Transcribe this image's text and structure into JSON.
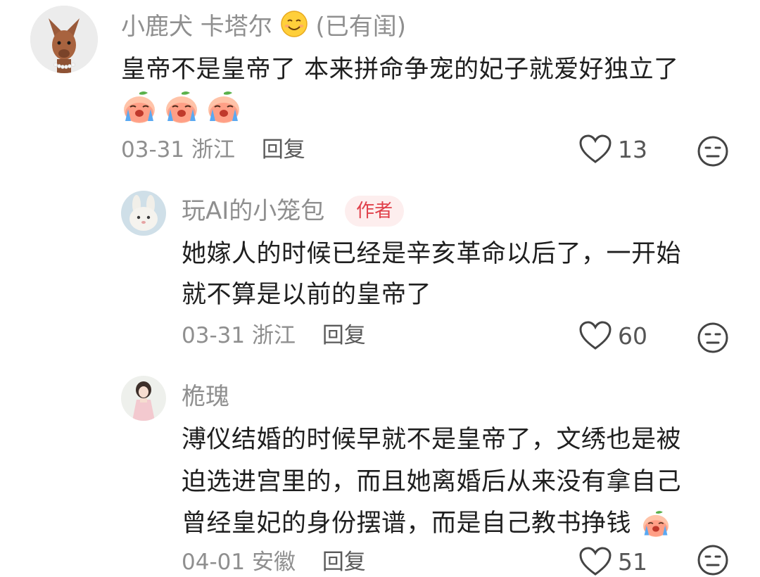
{
  "comments": [
    {
      "username": "小鹿犬 卡塔尔",
      "status": "(已有闺)",
      "lines": [
        "皇帝不是皇帝了 本来拼命争宠的妃子就爱好独立了"
      ],
      "emojis": [
        "crying-peach-emoji",
        "crying-peach-emoji",
        "crying-peach-emoji"
      ],
      "date": "03-31",
      "location": "浙江",
      "reply_label": "回复",
      "likes": "13"
    },
    {
      "username": "玩AI的小笼包",
      "author_tag": "作者",
      "lines": [
        "她嫁人的时候已经是辛亥革命以后了，一开始",
        "就不算是以前的皇帝了"
      ],
      "date": "03-31",
      "location": "浙江",
      "reply_label": "回复",
      "likes": "60"
    },
    {
      "username": "桅瑰",
      "lines": [
        "溥仪结婚的时候早就不是皇帝了，文绣也是被",
        "迫选进宫里的，而且她离婚后从来没有拿自己",
        "曾经皇妃的身份摆谱，而是自己教书挣钱"
      ],
      "date": "04-01",
      "location": "安徽",
      "reply_label": "回复",
      "likes": "51"
    }
  ],
  "colors": {
    "username": "#8f8f8f",
    "text": "#1f1f1f",
    "author_tag_bg": "#fdeeee",
    "author_tag_text": "#e0404a"
  }
}
